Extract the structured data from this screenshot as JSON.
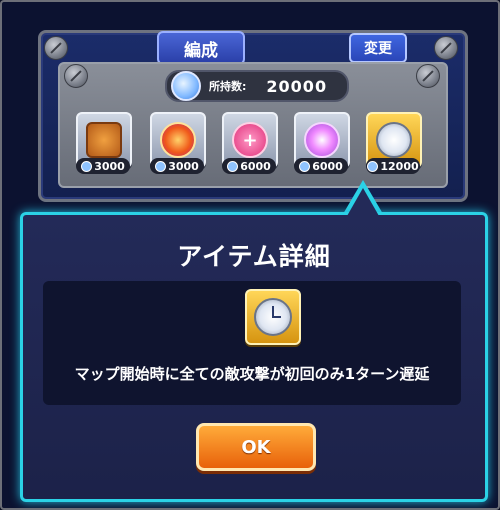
{
  "header": {
    "formation_tab": "編成",
    "change_button": "変更"
  },
  "owned": {
    "label": "所持数:",
    "value": "20000"
  },
  "items": [
    {
      "name": "treasure-chest-icon",
      "cost": "3000",
      "selected": false
    },
    {
      "name": "fire-orb-icon",
      "cost": "3000",
      "selected": false
    },
    {
      "name": "heart-plus-icon",
      "cost": "6000",
      "selected": false
    },
    {
      "name": "sparkle-orb-icon",
      "cost": "6000",
      "selected": false
    },
    {
      "name": "clock-delay-icon",
      "cost": "12000",
      "selected": true
    }
  ],
  "dialog": {
    "title": "アイテム詳細",
    "description": "マップ開始時に全ての敵攻撃が初回のみ1ターン遅延",
    "ok_label": "OK"
  },
  "colors": {
    "accent_cyan": "#2bd2e6",
    "ok_orange": "#f07a14",
    "selected_gold": "#f2b535"
  }
}
